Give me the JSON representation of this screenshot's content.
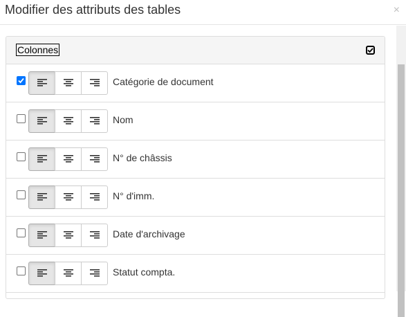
{
  "dialog": {
    "title": "Modifier des attributs des tables",
    "close_glyph": "×"
  },
  "panel": {
    "heading": "Colonnes",
    "select_all_checked": true
  },
  "rows": [
    {
      "label": "Catégorie de document",
      "checked": true,
      "align": "left"
    },
    {
      "label": "Nom",
      "checked": false,
      "align": "left"
    },
    {
      "label": "N° de châssis",
      "checked": false,
      "align": "left"
    },
    {
      "label": "N° d'imm.",
      "checked": false,
      "align": "left"
    },
    {
      "label": "Date d'archivage",
      "checked": false,
      "align": "left"
    },
    {
      "label": "Statut compta.",
      "checked": false,
      "align": "left"
    }
  ],
  "icons": {
    "align_left": "align-left-icon",
    "align_center": "align-center-icon",
    "align_right": "align-right-icon"
  },
  "colors": {
    "checkbox_accent": "#0075ff",
    "active_button_bg": "#e6e6e6"
  }
}
